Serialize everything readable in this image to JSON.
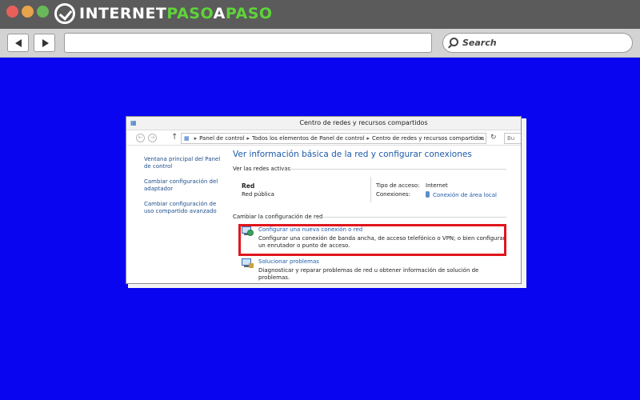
{
  "browser": {
    "brand": {
      "part1": "INTERNET",
      "part2": "PASO",
      "part3": "A",
      "part4": "PASO"
    },
    "search_placeholder": "Search",
    "colors": {
      "page_background": "#0a05f0",
      "brand_green": "#5ed43a",
      "highlight_red": "#e0151b"
    }
  },
  "window": {
    "title": "Centro de redes y recursos compartidos",
    "breadcrumb": [
      "Panel de control",
      "Todos los elementos de Panel de control",
      "Centro de redes y recursos compartidos"
    ],
    "search_placeholder": "Bu",
    "sidebar": [
      {
        "label": "Ventana principal del Panel de control"
      },
      {
        "label": "Cambiar configuración del adaptador"
      },
      {
        "label": "Cambiar configuración de uso compartido avanzado"
      }
    ],
    "main": {
      "heading": "Ver información básica de la red y configurar conexiones",
      "active_networks_label": "Ver las redes activas",
      "network_name": "Red",
      "network_type": "Red pública",
      "access_type_label": "Tipo de acceso:",
      "access_type_value": "Internet",
      "connections_label": "Conexiones:",
      "connections_value": "Conexión de área local",
      "change_settings_label": "Cambiar la configuración de red",
      "tasks": [
        {
          "title": "Configurar una nueva conexión o red",
          "description": "Configurar una conexión de banda ancha, de acceso telefónico o VPN; o bien configurar un enrutador o punto de acceso.",
          "icon": "network-setup-icon"
        },
        {
          "title": "Solucionar problemas",
          "description": "Diagnosticar y reparar problemas de red u obtener información de solución de problemas.",
          "icon": "troubleshoot-icon"
        }
      ]
    }
  }
}
